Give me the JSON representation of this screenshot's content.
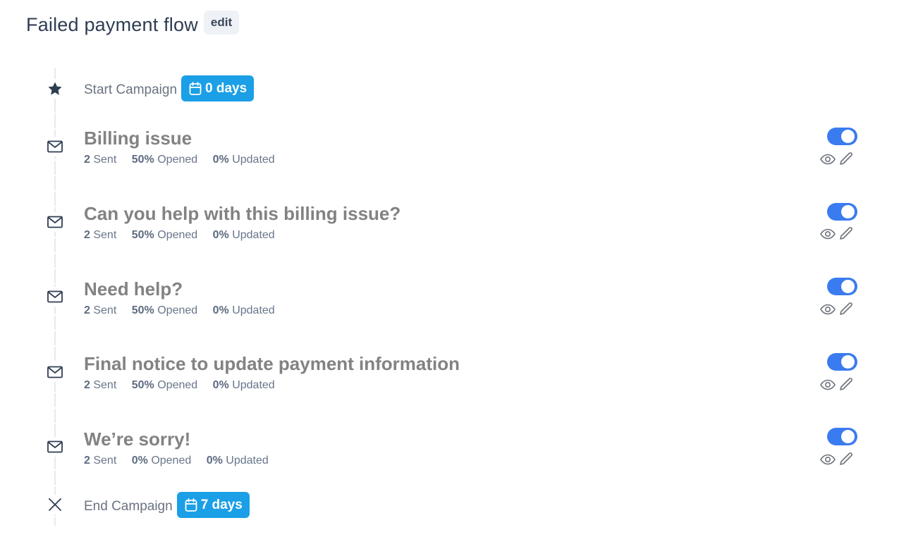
{
  "header": {
    "title": "Failed payment flow",
    "edit_label": "edit"
  },
  "start": {
    "label": "Start Campaign",
    "days": "0 days",
    "icon": "star-icon"
  },
  "end": {
    "label": "End Campaign",
    "days": "7 days",
    "icon": "close-icon"
  },
  "colors": {
    "accent": "#1b9fe6",
    "toggle_on": "#3b7bf0",
    "title_gray": "#828282"
  },
  "steps": [
    {
      "title": "Billing issue",
      "sent": "2",
      "sent_label": "Sent",
      "opened": "50%",
      "opened_label": "Opened",
      "updated": "0%",
      "updated_label": "Updated",
      "enabled": true
    },
    {
      "title": "Can you help with this billing issue?",
      "sent": "2",
      "sent_label": "Sent",
      "opened": "50%",
      "opened_label": "Opened",
      "updated": "0%",
      "updated_label": "Updated",
      "enabled": true
    },
    {
      "title": "Need help?",
      "sent": "2",
      "sent_label": "Sent",
      "opened": "50%",
      "opened_label": "Opened",
      "updated": "0%",
      "updated_label": "Updated",
      "enabled": true
    },
    {
      "title": "Final notice to update payment information",
      "sent": "2",
      "sent_label": "Sent",
      "opened": "50%",
      "opened_label": "Opened",
      "updated": "0%",
      "updated_label": "Updated",
      "enabled": true
    },
    {
      "title": "We’re sorry!",
      "sent": "2",
      "sent_label": "Sent",
      "opened": "0%",
      "opened_label": "Opened",
      "updated": "0%",
      "updated_label": "Updated",
      "enabled": true
    }
  ]
}
